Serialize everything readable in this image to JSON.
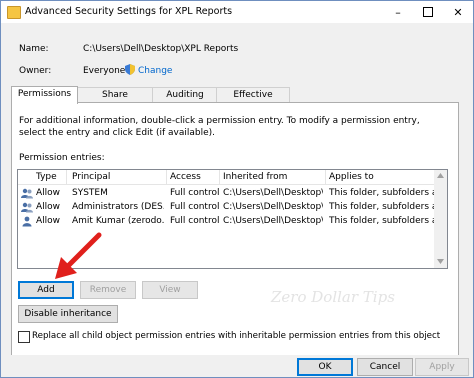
{
  "window": {
    "title": "Advanced Security Settings for XPL Reports",
    "minimize": "–",
    "close": "✕"
  },
  "info": {
    "name_label": "Name:",
    "name_value": "C:\\Users\\Dell\\Desktop\\XPL Reports",
    "owner_label": "Owner:",
    "owner_value": "Everyone",
    "change_link": "Change"
  },
  "tabs": [
    {
      "label": "Permissions",
      "active": true
    },
    {
      "label": "Share"
    },
    {
      "label": "Auditing"
    },
    {
      "label": "Effective Access"
    }
  ],
  "permissions": {
    "description": "For additional information, double-click a permission entry. To modify a permission entry, select the entry and click Edit (if available).",
    "entries_label": "Permission entries:",
    "columns": [
      "Type",
      "Principal",
      "Access",
      "Inherited from",
      "Applies to"
    ],
    "rows": [
      {
        "type": "Allow",
        "principal": "SYSTEM",
        "access": "Full control",
        "inherited": "C:\\Users\\Dell\\Desktop\\",
        "applies": "This folder, subfolders and files"
      },
      {
        "type": "Allow",
        "principal": "Administrators (DES...",
        "access": "Full control",
        "inherited": "C:\\Users\\Dell\\Desktop\\",
        "applies": "This folder, subfolders and files"
      },
      {
        "type": "Allow",
        "principal": "Amit Kumar (zerodo...",
        "access": "Full control",
        "inherited": "C:\\Users\\Dell\\Desktop\\",
        "applies": "This folder, subfolders and files"
      }
    ],
    "add_button": "Add",
    "remove_button": "Remove",
    "view_button": "View",
    "disable_inheritance_button": "Disable inheritance",
    "replace_checkbox_label": "Replace all child object permission entries with inheritable permission entries from this object",
    "replace_checked": false
  },
  "watermark": "Zero Dollar Tips",
  "footer": {
    "ok": "OK",
    "cancel": "Cancel",
    "apply": "Apply"
  },
  "colors": {
    "accent": "#0078d7",
    "link": "#0066cc",
    "arrow": "#e0201c"
  }
}
